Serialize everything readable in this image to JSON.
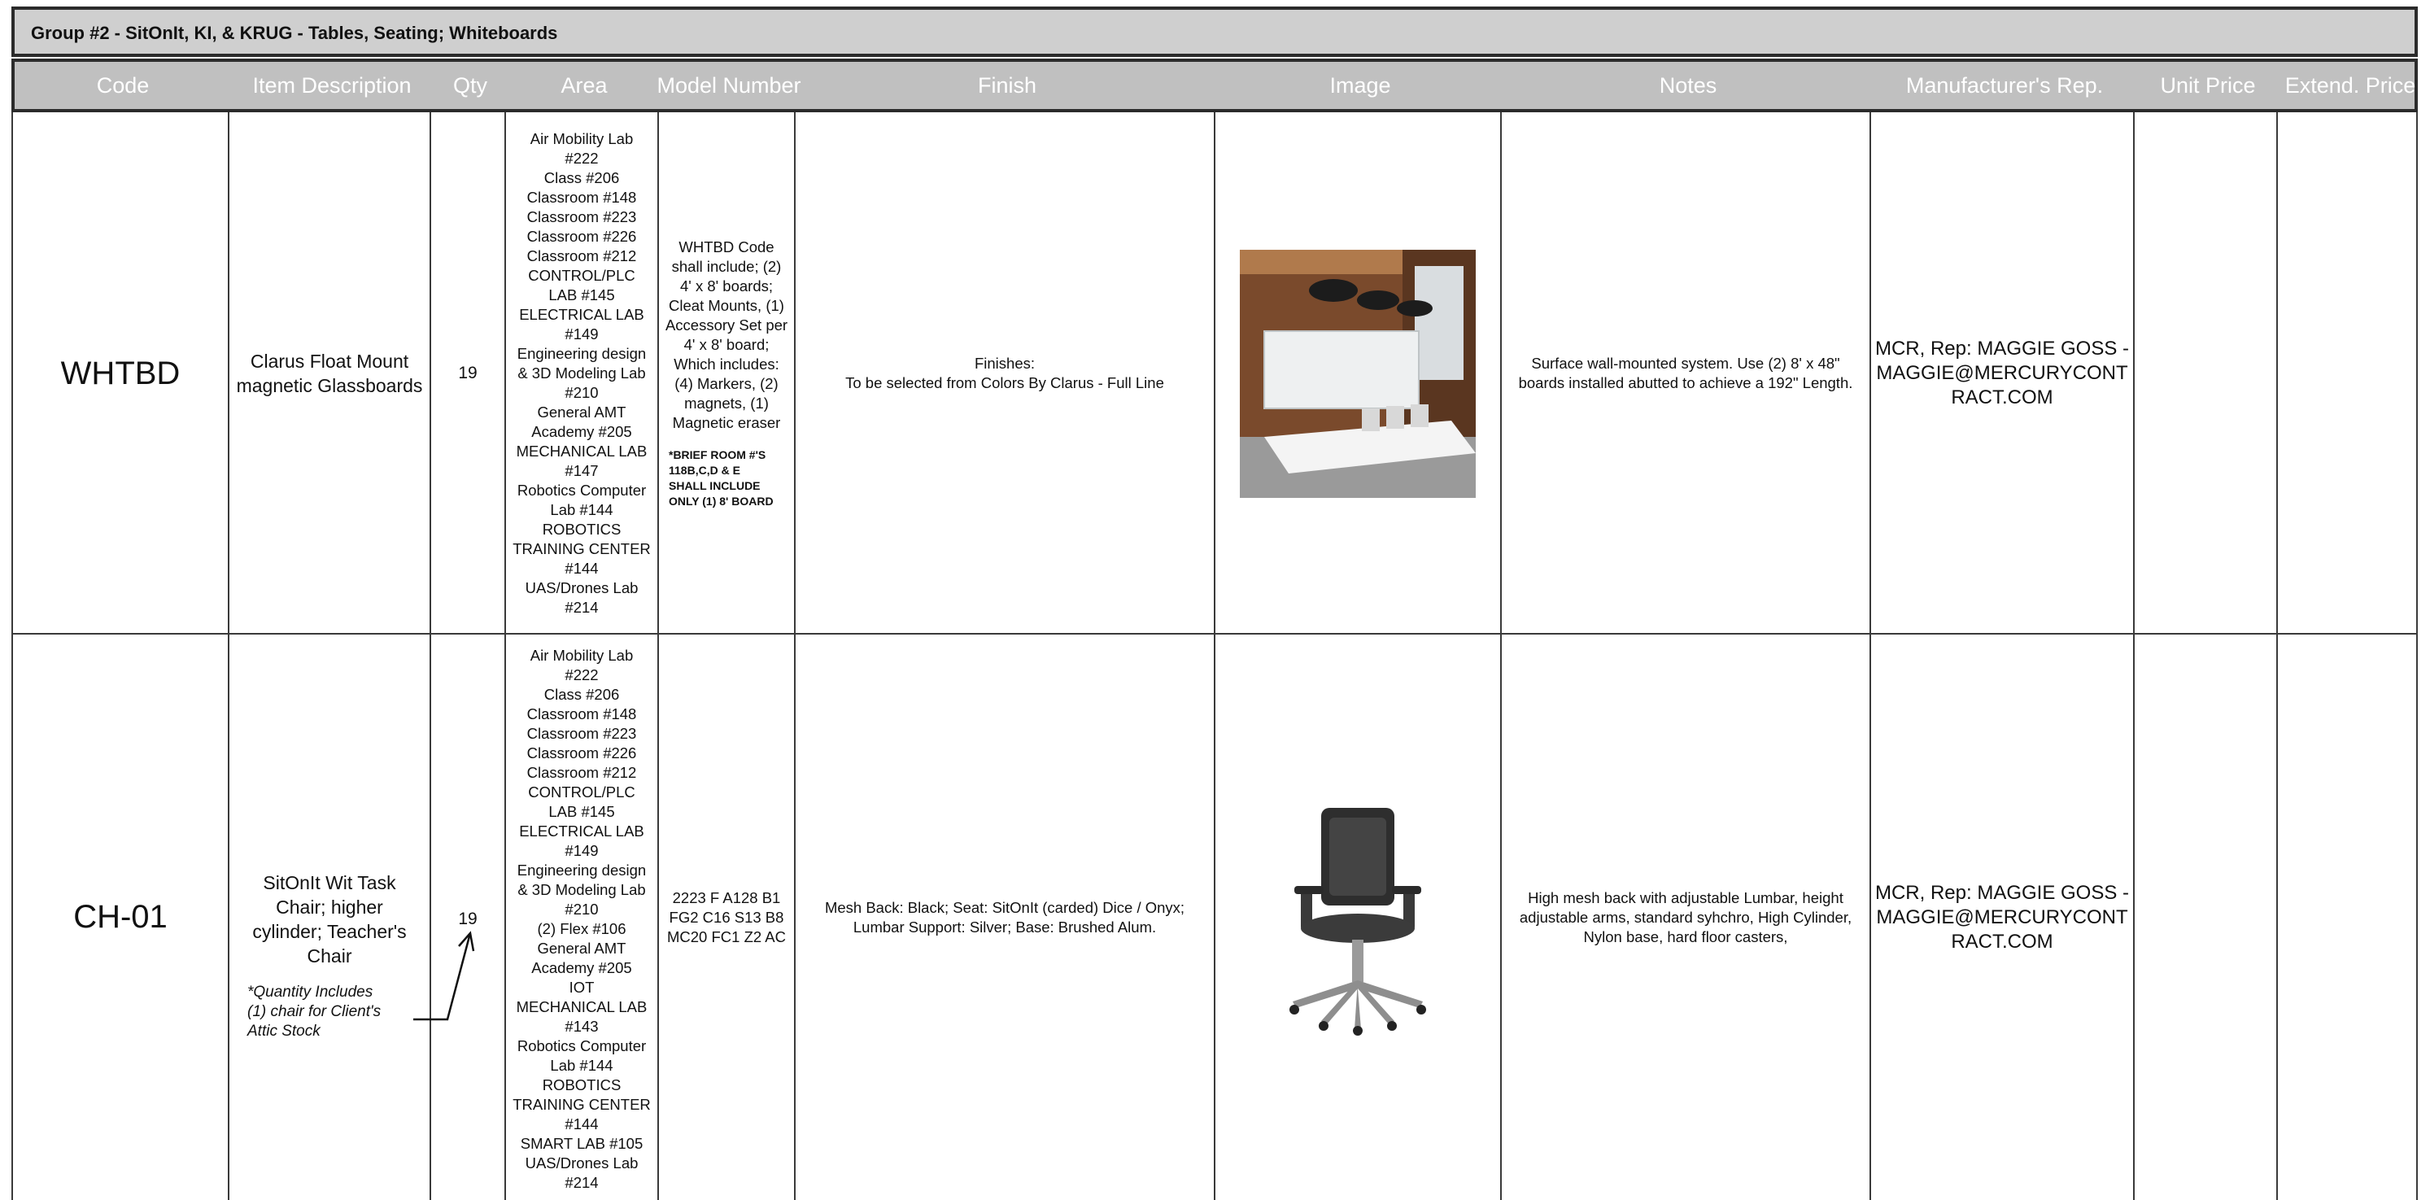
{
  "group_title": "Group #2 - SitOnIt, KI, & KRUG - Tables, Seating; Whiteboards",
  "headers": {
    "code": "Code",
    "item_description": "Item Description",
    "qty": "Qty",
    "area": "Area",
    "model_number": "Model Number",
    "finish": "Finish",
    "image": "Image",
    "notes": "Notes",
    "rep": "Manufacturer's Rep.",
    "unit_price": "Unit Price",
    "extend_price": "Extend. Price"
  },
  "rows": [
    {
      "code": "WHTBD",
      "description": [
        "Clarus Float Mount",
        "magnetic Glassboards"
      ],
      "qty": "19",
      "area": [
        "Air Mobility Lab",
        "#222",
        "Class #206",
        "Classroom #148",
        "Classroom #223",
        "Classroom #226",
        "Classroom #212",
        "CONTROL/PLC",
        "LAB #145",
        "ELECTRICAL LAB",
        "#149",
        "Engineering design",
        "& 3D Modeling Lab",
        "#210",
        "General AMT",
        "Academy #205",
        "MECHANICAL LAB",
        "#147",
        "Robotics Computer",
        "Lab #144",
        "ROBOTICS",
        "TRAINING CENTER",
        "#144",
        "UAS/Drones Lab",
        "#214"
      ],
      "model": [
        "WHTBD Code",
        "shall include; (2)",
        "4' x 8' boards;",
        "Cleat Mounts, (1)",
        "Accessory Set per",
        "4' x 8' board;",
        "Which includes:",
        "(4) Markers, (2)",
        "magnets, (1)",
        "Magnetic eraser"
      ],
      "model_note": [
        "*BRIEF ROOM #'S",
        "118B,C,D & E",
        "SHALL INCLUDE",
        "ONLY (1) 8' BOARD"
      ],
      "finish": [
        "Finishes:",
        "To be selected from Colors By Clarus - Full Line"
      ],
      "image_icon": "conference-room-glassboard-photo",
      "notes": [
        "Surface wall-mounted system.  Use (2) 8' x 48\"",
        "boards installed abutted to achieve a 192\" Length."
      ],
      "rep": [
        "MCR, Rep: MAGGIE GOSS -",
        "MAGGIE@MERCURYCONT",
        "RACT.COM"
      ]
    },
    {
      "code": "CH-01",
      "description": [
        "SitOnIt Wit Task",
        "Chair;  higher",
        "cylinder; Teacher's",
        "Chair"
      ],
      "description_note": [
        "*Quantity Includes",
        "(1) chair for Client's",
        "Attic Stock"
      ],
      "qty": "19",
      "area": [
        "Air Mobility Lab",
        "#222",
        "Class #206",
        "Classroom #148",
        "Classroom #223",
        "Classroom #226",
        "Classroom #212",
        "CONTROL/PLC",
        "LAB #145",
        "ELECTRICAL LAB",
        "#149",
        "Engineering design",
        "& 3D Modeling Lab",
        "#210",
        "(2) Flex #106",
        "General AMT",
        "Academy #205",
        "IOT",
        "MECHANICAL LAB",
        "#143",
        "Robotics Computer",
        "Lab #144",
        "ROBOTICS",
        "TRAINING CENTER",
        "#144",
        "SMART LAB #105",
        "UAS/Drones Lab",
        "#214"
      ],
      "model": [
        "2223 F A128 B1",
        "FG2 C16 S13 B8",
        "MC20 FC1 Z2 AC"
      ],
      "finish": [
        "Mesh Back: Black; Seat:  SitOnIt (carded) Dice / Onyx;",
        "Lumbar Support: Silver; Base: Brushed Alum."
      ],
      "image_icon": "task-chair-photo",
      "notes": [
        "High mesh back with adjustable Lumbar, height",
        "adjustable arms, standard syhchro, High Cylinder,",
        "Nylon base, hard floor casters,"
      ],
      "rep": [
        "MCR, Rep: MAGGIE GOSS -",
        "MAGGIE@MERCURYCONT",
        "RACT.COM"
      ]
    }
  ]
}
